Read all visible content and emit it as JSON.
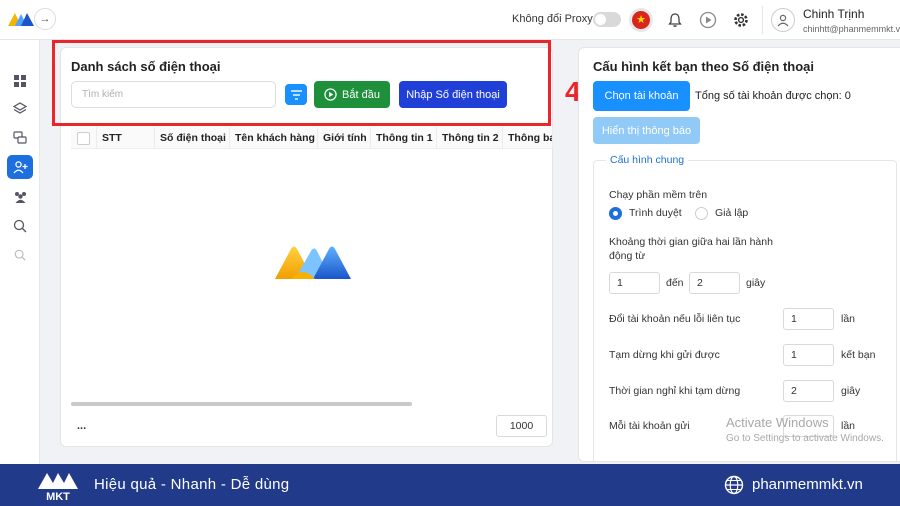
{
  "topbar": {
    "proxy_label": "Không đổi Proxy",
    "user_name": "Chinh Trịnh",
    "user_email": "chinhtt@phanmemmkt.vn",
    "flag_star": "★"
  },
  "left_panel": {
    "title": "Danh sách số điện thoại",
    "search_placeholder": "Tìm kiếm",
    "start_label": "Bắt đầu",
    "import_label": "Nhập Số điện thoại",
    "columns": [
      "STT",
      "Số điện thoại",
      "Tên khách hàng",
      "Giới tính",
      "Thông tin 1",
      "Thông tin 2",
      "Thông ba"
    ],
    "footer_dots": "...",
    "page_size": "1000"
  },
  "step_number": "4",
  "right_panel": {
    "title": "Cấu hình kết bạn theo Số điện thoại",
    "choose_account_label": "Chọn tài khoản",
    "total_selected": "Tổng số tài khoản được chọn: 0",
    "show_notify_label": "Hiển thị thông báo",
    "general_config": {
      "legend": "Cấu hình chung",
      "run_on_label": "Chạy phần mềm trên",
      "opt_browser": "Trình duyệt",
      "opt_emulator": "Giả lập",
      "interval_label_1": "Khoảng thời gian giữa hai lần hành",
      "interval_label_2": "động từ",
      "interval_from": "1",
      "interval_to_label": "đến",
      "interval_to": "2",
      "seconds_unit": "giây",
      "switch_label": "Đổi tài khoản nếu lỗi liên tục",
      "switch_value": "1",
      "times_unit": "lần",
      "pause_label": "Tạm dừng khi gửi được",
      "pause_value": "1",
      "friend_unit": "kết bạn",
      "rest_label": "Thời gian nghỉ khi tạm dừng",
      "rest_value": "2",
      "rest_unit": "giây",
      "each_label": "Mỗi tài khoản gửi",
      "each_unit": "lần"
    }
  },
  "watermark": {
    "title": "Activate Windows",
    "subtitle": "Go to Settings to activate Windows."
  },
  "banner": {
    "slogan": "Hiệu quả - Nhanh - Dễ dùng",
    "site": "phanmemmkt.vn",
    "logo_text": "MKT"
  }
}
